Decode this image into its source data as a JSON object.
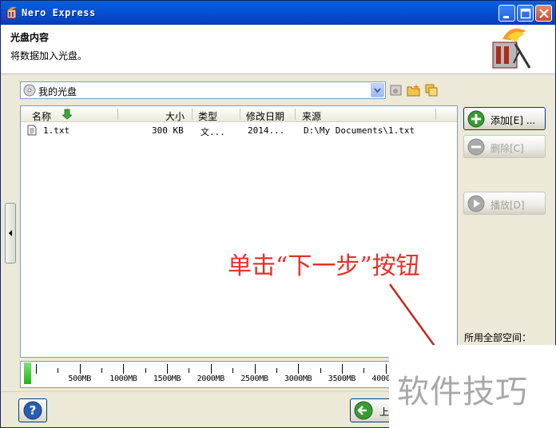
{
  "window": {
    "title": "Nero Express"
  },
  "header": {
    "title": "光盘内容",
    "subtitle": "将数据加入光盘。"
  },
  "disc_selector": {
    "value": "我的光盘"
  },
  "file_list": {
    "columns": [
      "名称",
      "大小",
      "类型",
      "修改日期",
      "来源"
    ],
    "rows": [
      {
        "name": "1.txt",
        "size": "300 KB",
        "type": "文...",
        "date": "2014...",
        "source": "D:\\My Documents\\1.txt"
      }
    ]
  },
  "actions": {
    "add_label": "添加[E] ...",
    "delete_label": "删除[C]",
    "play_label": "播放[D]"
  },
  "space": {
    "label": "所用全部空间："
  },
  "capacity": {
    "used_fraction": 0.002,
    "labels": [
      "500MB",
      "1000MB",
      "1500MB",
      "2000MB",
      "2500MB",
      "3000MB",
      "3500MB",
      "4000MB"
    ]
  },
  "bottom": {
    "back_label": "上一"
  },
  "annotation": {
    "text": "单击“下一步”按钮"
  },
  "watermark": {
    "text": "软件技巧"
  },
  "icons": {
    "app": "nero-flame-icon",
    "minimize": "minimize-icon",
    "maximize": "maximize-icon",
    "close": "close-icon",
    "disc": "disc-icon",
    "help": "help-icon",
    "back": "back-arrow-icon"
  },
  "colors": {
    "titlebar": "#0454d6",
    "annotation": "#e8302b",
    "capacity_fill": "#23b116"
  }
}
